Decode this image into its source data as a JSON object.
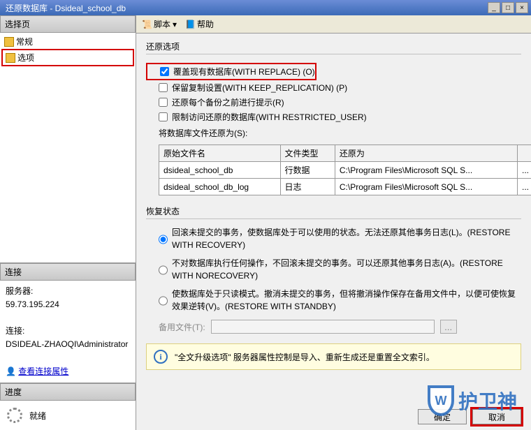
{
  "window": {
    "title": "还原数据库 - Dsideal_school_db",
    "min": "_",
    "max": "□",
    "close": "×"
  },
  "sidebar": {
    "nav_header": "选择页",
    "items": [
      {
        "label": "常规",
        "selected": false
      },
      {
        "label": "选项",
        "selected": true
      }
    ],
    "conn_header": "连接",
    "server_label": "服务器:",
    "server_value": "59.73.195.224",
    "conn_label": "连接:",
    "conn_value": "DSIDEAL-ZHAOQI\\Administrator",
    "view_conn": "查看连接属性",
    "progress_header": "进度",
    "progress_label": "就绪"
  },
  "toolbar": {
    "script": "脚本",
    "help": "帮助"
  },
  "restore_options": {
    "group_title": "还原选项",
    "opt1": "覆盖现有数据库(WITH REPLACE) (O)",
    "opt2": "保留复制设置(WITH KEEP_REPLICATION) (P)",
    "opt3": "还原每个备份之前进行提示(R)",
    "opt4": "限制访问还原的数据库(WITH RESTRICTED_USER)",
    "files_label": "将数据库文件还原为(S):",
    "table": {
      "col1": "原始文件名",
      "col2": "文件类型",
      "col3": "还原为",
      "row1": {
        "name": "dsideal_school_db",
        "type": "行数据",
        "path": "C:\\Program Files\\Microsoft SQL S..."
      },
      "row2": {
        "name": "dsideal_school_db_log",
        "type": "日志",
        "path": "C:\\Program Files\\Microsoft SQL S..."
      }
    }
  },
  "recovery_state": {
    "group_title": "恢复状态",
    "r1": "回滚未提交的事务，使数据库处于可以使用的状态。无法还原其他事务日志(L)。(RESTORE WITH RECOVERY)",
    "r2": "不对数据库执行任何操作，不回滚未提交的事务。可以还原其他事务日志(A)。(RESTORE WITH NORECOVERY)",
    "r3": "使数据库处于只读模式。撤消未提交的事务，但将撤消操作保存在备用文件中，以便可使恢复效果逆转(V)。(RESTORE WITH STANDBY)",
    "backup_label": "备用文件(T):"
  },
  "info": {
    "text": "\"全文升级选项\" 服务器属性控制是导入、重新生成还是重置全文索引。"
  },
  "footer": {
    "ok": "确定",
    "cancel": "取消"
  },
  "watermark": "护卫神"
}
